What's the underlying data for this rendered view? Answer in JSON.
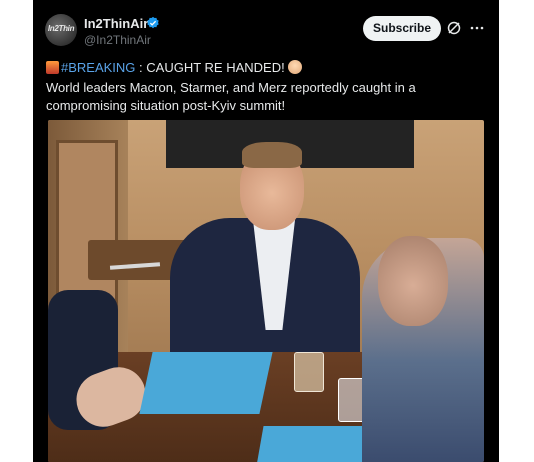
{
  "post": {
    "author": {
      "display_name": "In2ThinAir",
      "handle": "@In2ThinAir",
      "avatar_text": "In2Thin",
      "verified": true
    },
    "actions": {
      "subscribe_label": "Subscribe",
      "grok_icon": "grok-icon",
      "more_icon": "more-icon"
    },
    "text": {
      "hashtag": "#BREAKING",
      "headline": " : CAUGHT RE HANDED!",
      "line2": " World leaders Macron, Starmer, and Merz reportedly caught in a",
      "line3": "compromising situation post-Kyiv summit!"
    },
    "colors": {
      "background": "#000000",
      "text": "#e7e9ea",
      "muted": "#71767b",
      "hashtag": "#5aa3e8",
      "verified": "#1d9bf0",
      "button_bg": "#eff3f4"
    }
  }
}
